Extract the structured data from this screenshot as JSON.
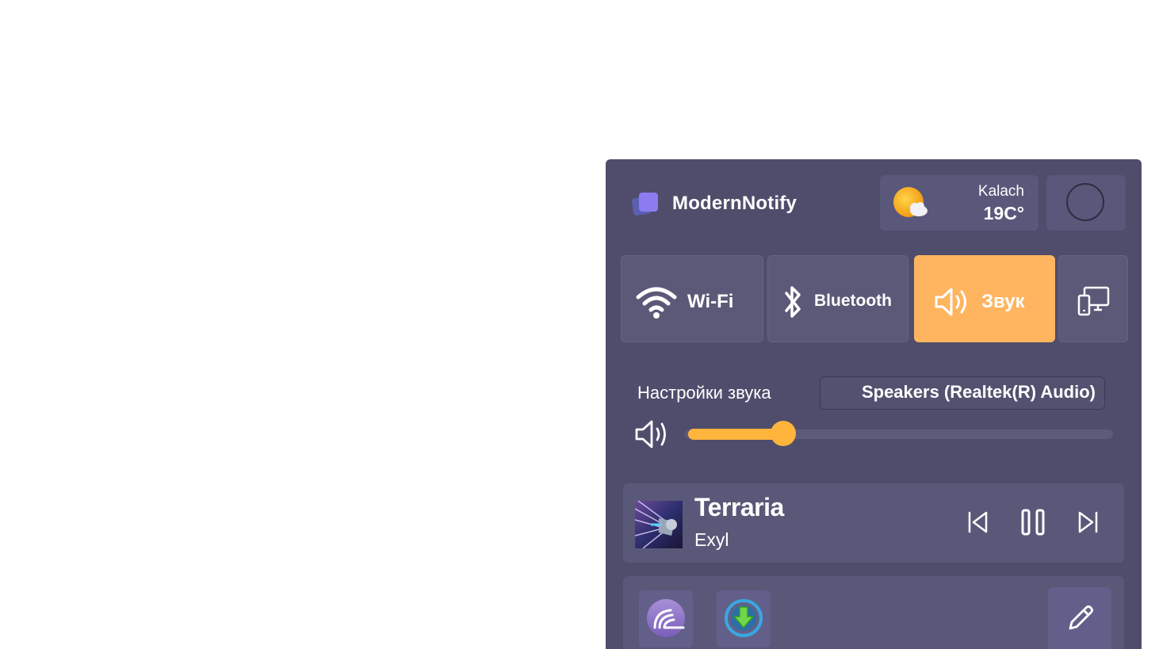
{
  "header": {
    "app_title": "ModernNotify",
    "logo_icon": "app-logo-icon"
  },
  "weather": {
    "city": "Kalach",
    "temperature": "19C°",
    "icon": "partly-cloudy-icon"
  },
  "tiles": [
    {
      "label": "Wi-Fi",
      "icon": "wifi-icon",
      "active": false
    },
    {
      "label": "Bluetooth",
      "icon": "bluetooth-icon",
      "active": false
    },
    {
      "label": "Звук",
      "icon": "speaker-icon",
      "active": true
    },
    {
      "label": "",
      "icon": "devices-icon",
      "active": false
    }
  ],
  "sound": {
    "title": "Настройки звука",
    "device": "Speakers (Realtek(R) Audio)",
    "volume_fraction": 0.23
  },
  "media": {
    "song": "Terraria",
    "artist": "Exyl",
    "controls": [
      "previous-icon",
      "pause-icon",
      "next-icon"
    ]
  },
  "apps": {
    "pinned": [
      "bittorrent-icon",
      "downloader-icon"
    ],
    "edit_icon": "pencil-icon"
  },
  "colors": {
    "panel_bg": "#4f4d6b",
    "accent": "#ffb460",
    "slider_fill": "#ffb43c"
  }
}
